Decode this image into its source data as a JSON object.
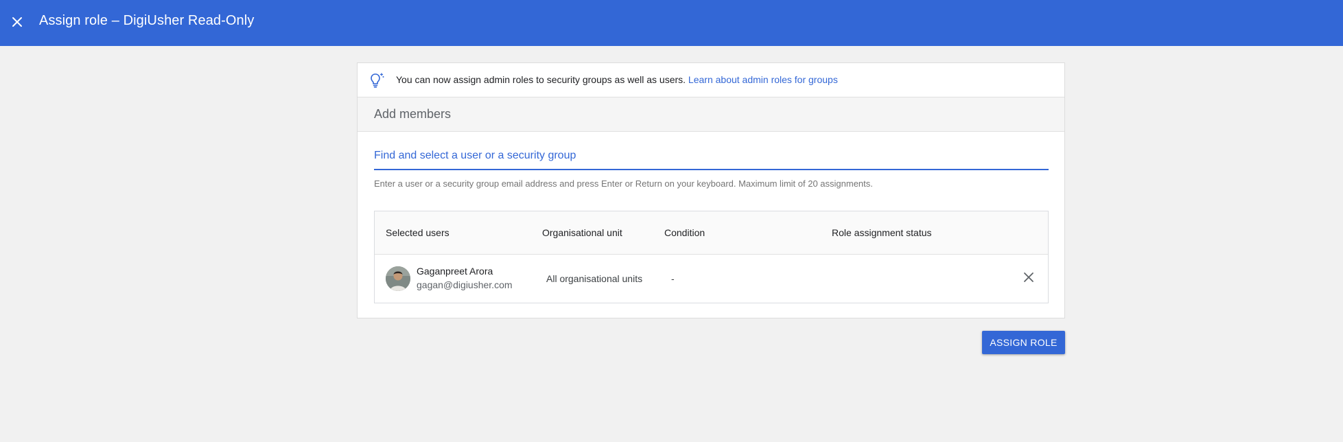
{
  "appbar": {
    "title": "Assign role – DigiUsher Read-Only",
    "close_icon": "close-icon"
  },
  "banner": {
    "icon": "lightbulb-icon",
    "text": "You can now assign admin roles to security groups as well as users.",
    "link": "Learn about admin roles for groups"
  },
  "section": {
    "title": "Add members"
  },
  "search": {
    "placeholder": "Find and select a user or a security group",
    "value": "",
    "hint": "Enter a user or a security group email address and press Enter or Return on your keyboard. Maximum limit of 20 assignments."
  },
  "table": {
    "columns": [
      "Selected users",
      "Organisational unit",
      "Condition",
      "Role assignment status"
    ],
    "rows": [
      {
        "name": "Gaganpreet Arora",
        "email": "gagan@digiusher.com",
        "org_unit": "All organisational units",
        "condition": "-",
        "status": ""
      }
    ]
  },
  "actions": {
    "assign_label": "ASSIGN ROLE"
  },
  "colors": {
    "primary": "#3367d6",
    "background": "#f1f1f1"
  }
}
